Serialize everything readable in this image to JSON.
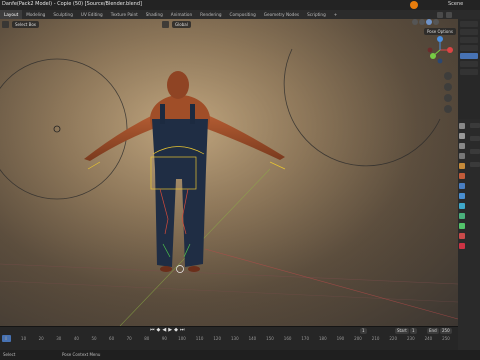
{
  "topbar": {
    "title": "Danfe(Pack2 Model) - Copie (50) [Source/Blender.blend]",
    "scene_label": "Scene"
  },
  "workspace_tabs": [
    "Layout",
    "Modeling",
    "Sculpting",
    "UV Editing",
    "Texture Paint",
    "Shading",
    "Animation",
    "Rendering",
    "Compositing",
    "Geometry Nodes",
    "Scripting",
    "+"
  ],
  "active_tab": "Layout",
  "viewport": {
    "mode_label": "Pose Mode",
    "select_box_label": "Select Box",
    "transform_label": "Global",
    "pose_options_label": "Pose Options"
  },
  "timeline": {
    "current_frame": "1",
    "start_label": "Start",
    "start_value": "1",
    "end_label": "End",
    "end_value": "250",
    "ruler_ticks": [
      "0",
      "10",
      "20",
      "30",
      "40",
      "50",
      "60",
      "70",
      "80",
      "90",
      "100",
      "110",
      "120",
      "130",
      "140",
      "150",
      "160",
      "170",
      "180",
      "190",
      "200",
      "210",
      "220",
      "230",
      "240",
      "250"
    ]
  },
  "statusbar": {
    "select_label": "Select",
    "context_menu_label": "Pose Context Menu"
  },
  "colors": {
    "accent": "#4772b3",
    "blender_logo": "#e87d0d",
    "skin": "#a5522c",
    "overalls": "#1f2d44",
    "bone_yellow": "#e8c531"
  }
}
